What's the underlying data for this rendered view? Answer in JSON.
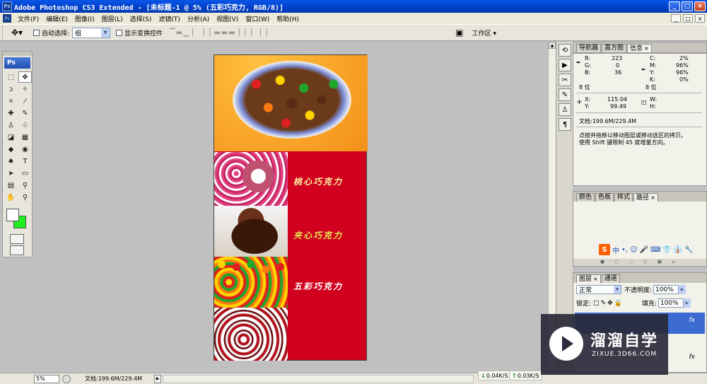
{
  "window": {
    "title": "Adobe Photoshop CS3 Extended - [未标题-1 @ 5% (五彩巧克力, RGB/8)]",
    "app_icon": "Ps",
    "buttons": [
      "_",
      "□",
      "×"
    ]
  },
  "menu": {
    "items": [
      "文件(F)",
      "编辑(E)",
      "图像(I)",
      "图层(L)",
      "选择(S)",
      "滤镜(T)",
      "分析(A)",
      "视图(V)",
      "窗口(W)",
      "帮助(H)"
    ],
    "mini_buttons": [
      "_",
      "□",
      "×"
    ]
  },
  "options": {
    "auto_select_label": "自动选择:",
    "auto_select_value": "组",
    "show_transform_label": "显示变换控件",
    "workspace_label": "工作区 ▾"
  },
  "toolbox": {
    "logo": "Ps"
  },
  "document": {
    "texts": [
      "桃心巧克力",
      "夹心巧克力",
      "五彩巧克力"
    ]
  },
  "panels": {
    "info_tabs": [
      "导航器",
      "直方图",
      "信息"
    ],
    "info": {
      "R_label": "R:",
      "R": "223",
      "G_label": "G:",
      "G": "0",
      "B_label": "B:",
      "B": "36",
      "C_label": "C:",
      "C": "2%",
      "M_label": "M:",
      "M": "96%",
      "Y_label": "Y:",
      "Y": "96%",
      "K_label": "K:",
      "K": "0%",
      "bit_left": "8 位",
      "bit_right": "8 位",
      "X_label": "X:",
      "X": "115.04",
      "Y2_label": "Y:",
      "Y2": "99.49",
      "W_label": "W:",
      "H_label": "H:",
      "doc": "文档:199.6M/229.4M",
      "hint1": "点按并拖移以移动图层或移动选区的拷贝。",
      "hint2": "使用 Shift 键限制 45 度增量方向。"
    },
    "color_tabs": [
      "颜色",
      "色板",
      "样式",
      "路径"
    ],
    "ime": {
      "logo": "S",
      "label": "中",
      "glyphs": [
        "•,",
        "☺",
        "🎤",
        "⌨",
        "👕",
        "👔",
        "🔧"
      ]
    },
    "layers_tabs": [
      "图层",
      "通道"
    ],
    "blend_mode": "正常",
    "opacity_label": "不透明度:",
    "opacity": "100%",
    "lock_label": "锁定:",
    "fill_label": "填充:",
    "fill": "100%",
    "fx": "fx"
  },
  "status": {
    "zoom": "5%",
    "doc": "文档:199.6M/229.4M",
    "down_speed": "0.04K/S",
    "up_speed": "0.03K/S"
  },
  "watermark": {
    "cn": "溜溜自学",
    "en": "ZIXUE.3D66.COM"
  }
}
